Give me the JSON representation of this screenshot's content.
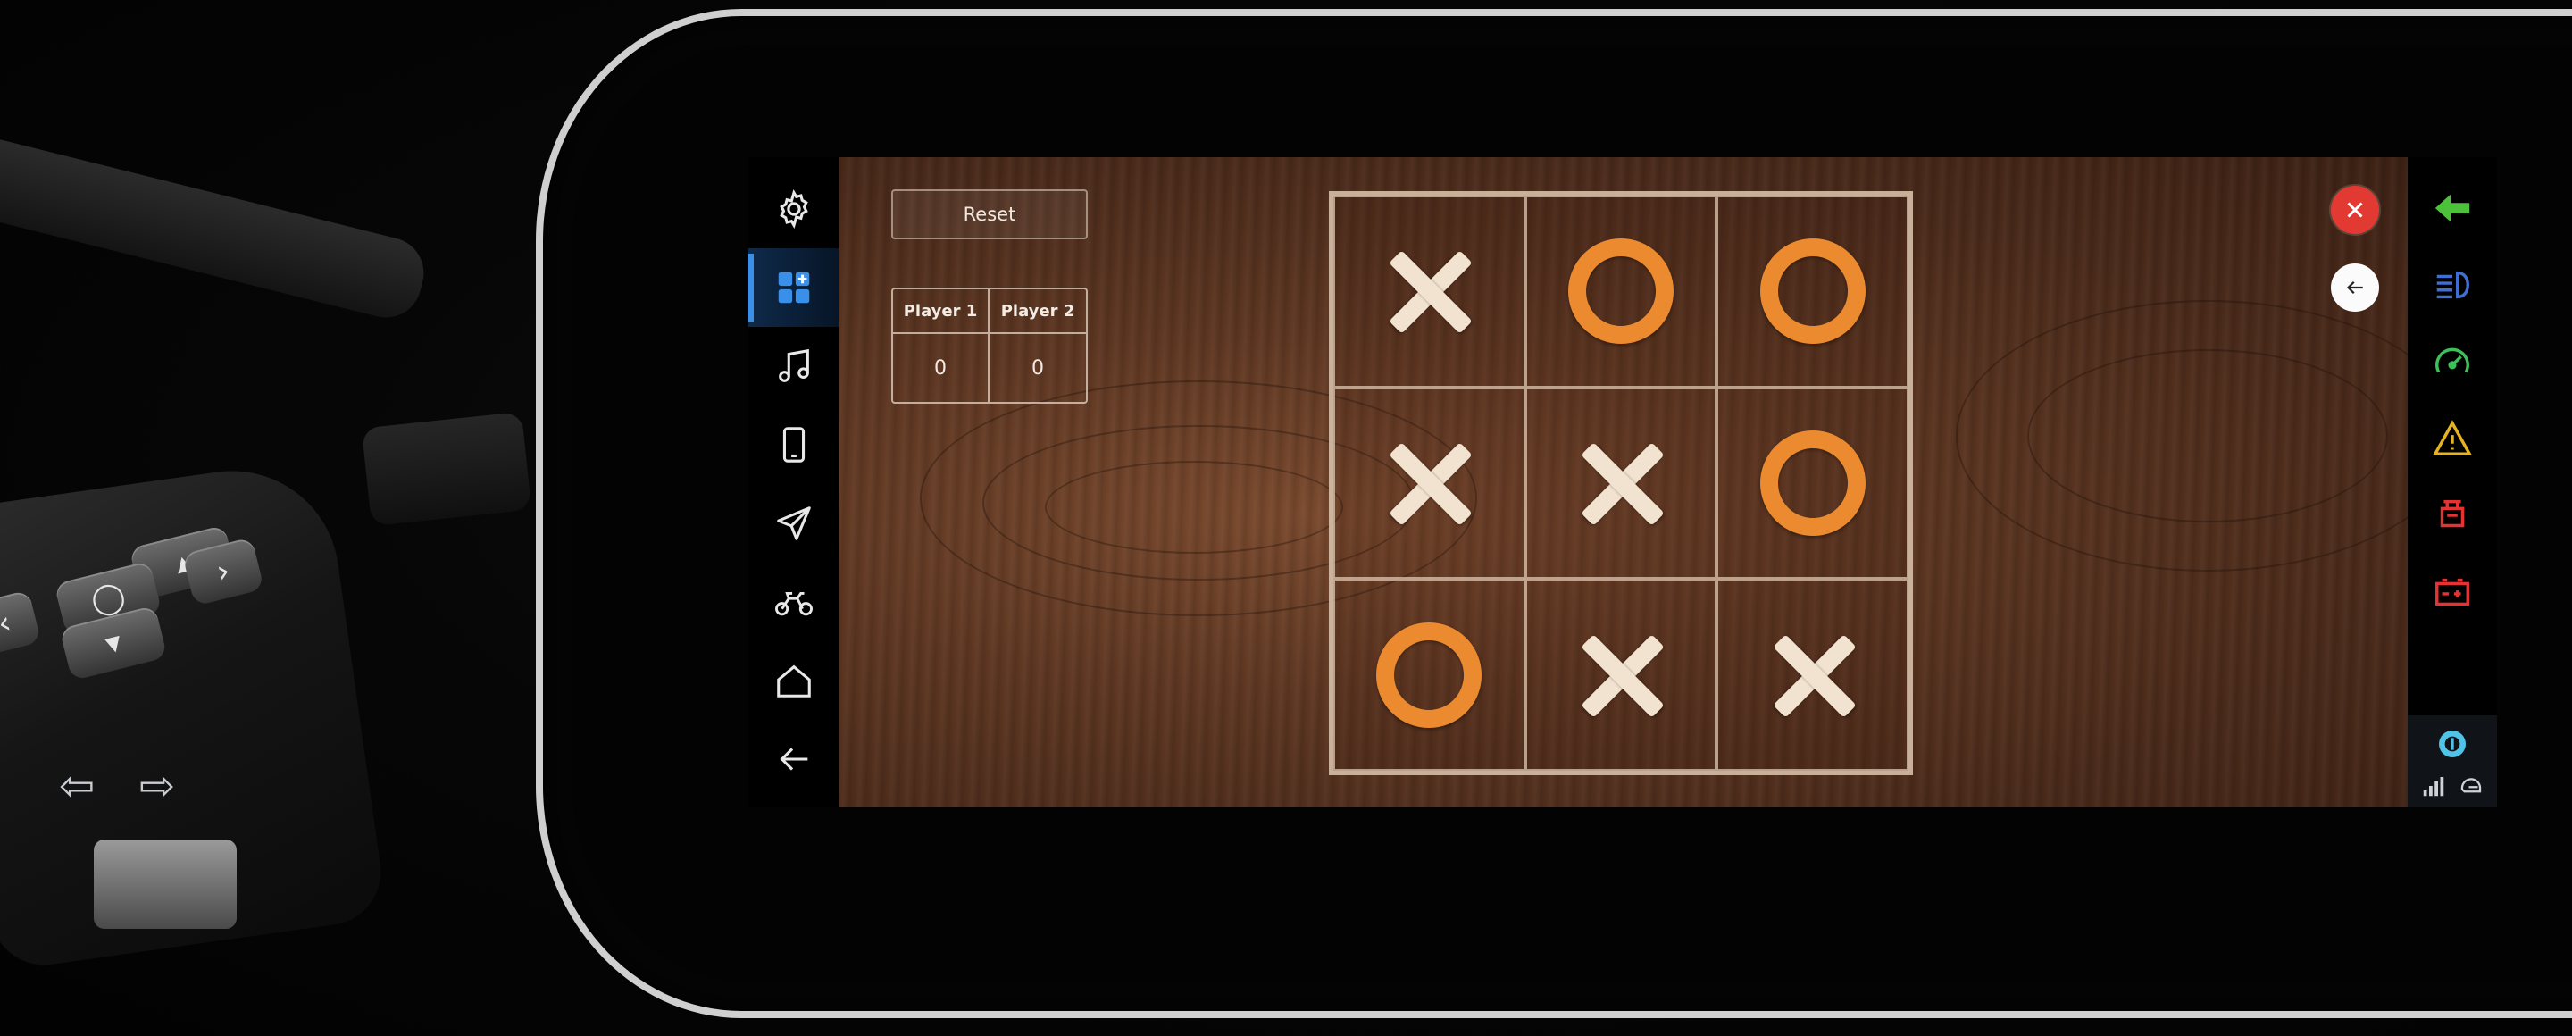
{
  "game": {
    "reset_label": "Reset",
    "scoreboard": {
      "players": [
        {
          "label": "Player 1",
          "score": "0"
        },
        {
          "label": "Player 2",
          "score": "0"
        }
      ]
    },
    "board": [
      "X",
      "O",
      "O",
      "X",
      "X",
      "O",
      "O",
      "X",
      "X"
    ]
  },
  "sidebar": {
    "items": [
      {
        "icon": "settings-icon"
      },
      {
        "icon": "apps-grid-icon",
        "active": true
      },
      {
        "icon": "music-icon"
      },
      {
        "icon": "phone-icon"
      },
      {
        "icon": "navigation-icon"
      },
      {
        "icon": "motorcycle-icon"
      },
      {
        "icon": "home-icon"
      },
      {
        "icon": "back-arrow-icon"
      }
    ]
  },
  "telltales": {
    "items": [
      {
        "icon": "turn-left-indicator-icon",
        "color": "#4cc23a"
      },
      {
        "icon": "low-beam-icon",
        "color": "#3f6fd6"
      },
      {
        "icon": "speedometer-icon",
        "color": "#3fbf5a"
      },
      {
        "icon": "warning-triangle-icon",
        "color": "#e5b321"
      },
      {
        "icon": "engine-fault-icon",
        "color": "#e53232"
      },
      {
        "icon": "battery-icon",
        "color": "#e53232"
      }
    ],
    "status": [
      "voice-assistant-icon",
      "signal-strength-icon",
      "helmet-connect-icon"
    ]
  },
  "colors": {
    "x_mark": "#f1e3cf",
    "o_mark": "#ec8a2f",
    "close": "#e23a32",
    "accent": "#3a8fe8"
  }
}
